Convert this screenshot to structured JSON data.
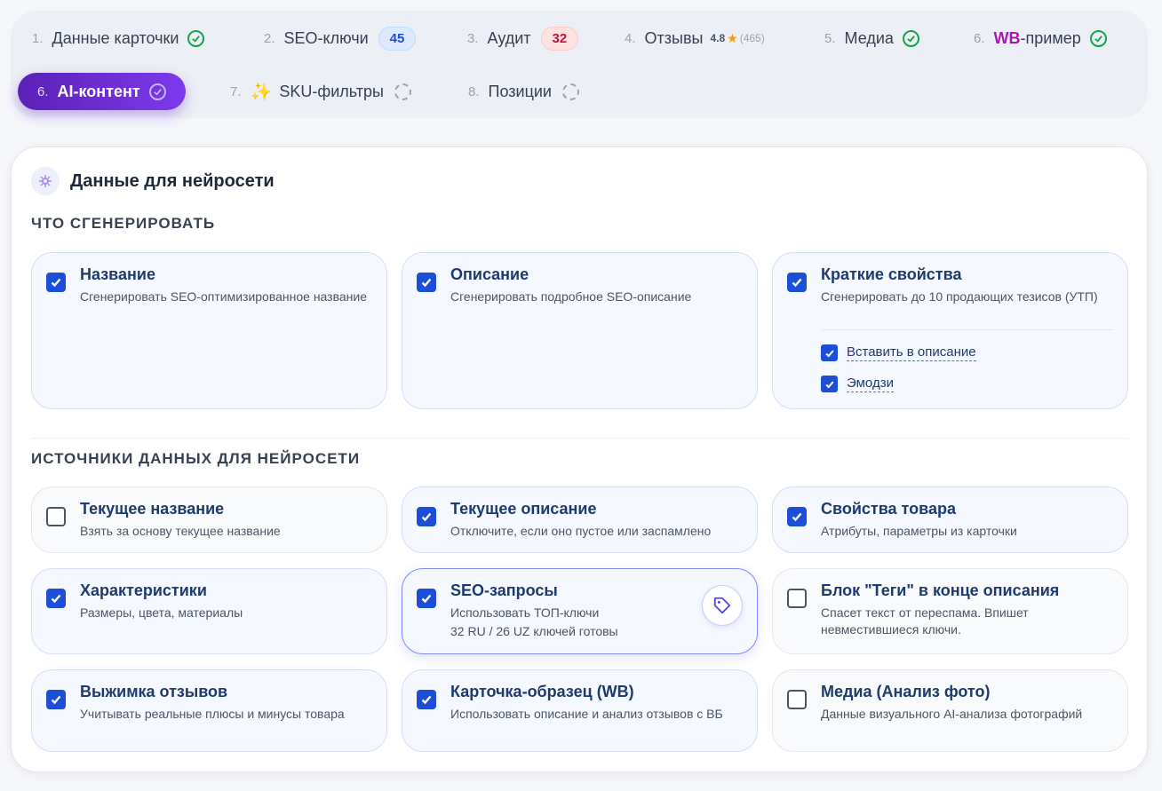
{
  "tabs": [
    {
      "num": "1.",
      "label": "Данные карточки",
      "status": "done"
    },
    {
      "num": "2.",
      "label": "SEO-ключи",
      "badge": "45"
    },
    {
      "num": "3.",
      "label": "Аудит",
      "badge": "32"
    },
    {
      "num": "4.",
      "label": "Отзывы",
      "rating": "4.8",
      "rating_count": "(465)"
    },
    {
      "num": "5.",
      "label": "Медиа",
      "status": "done"
    },
    {
      "num": "6.",
      "label_brand": "WB",
      "label_rest": "-пример",
      "status": "done"
    },
    {
      "num": "6.",
      "label": "AI-контент",
      "status": "done",
      "active": true
    },
    {
      "num": "7.",
      "label": "SKU-фильтры",
      "status": "pending"
    },
    {
      "num": "8.",
      "label": "Позиции",
      "status": "pending"
    }
  ],
  "card": {
    "title": "Данные для нейросети",
    "section_generate": "ЧТО СГЕНЕРИРОВАТЬ",
    "section_sources": "ИСТОЧНИКИ ДАННЫХ ДЛЯ НЕЙРОСЕТИ"
  },
  "generate": [
    {
      "title": "Название",
      "desc": "Сгенерировать SEO-оптимизированное название",
      "checked": true
    },
    {
      "title": "Описание",
      "desc": "Сгенерировать подробное SEO-описание",
      "checked": true
    },
    {
      "title": "Краткие свойства",
      "desc": "Сгенерировать до 10 продающих тезисов (УТП)",
      "checked": true,
      "sub": [
        {
          "label": "Вставить в описание",
          "checked": true
        },
        {
          "label": "Эмодзи",
          "checked": true
        }
      ]
    }
  ],
  "sources": [
    {
      "title": "Текущее название",
      "desc": "Взять за основу текущее название",
      "checked": false
    },
    {
      "title": "Текущее описание",
      "desc": "Отключите, если оно пустое или заспамлено",
      "checked": true
    },
    {
      "title": "Свойства товара",
      "desc": "Атрибуты, параметры из карточки",
      "checked": true
    },
    {
      "title": "Характеристики",
      "desc": "Размеры, цвета, материалы",
      "checked": true
    },
    {
      "title": "SEO-запросы",
      "desc": "Использовать ТОП-ключи",
      "extra": "32 RU / 26 UZ ключей готовы",
      "checked": true
    },
    {
      "title": "Блок \"Теги\" в конце описания",
      "desc": "Спасет текст от переспама. Впишет невместившиеся ключи.",
      "checked": false
    },
    {
      "title": "Выжимка отзывов",
      "desc": "Учитывать реальные плюсы и минусы товара",
      "checked": true
    },
    {
      "title": "Карточка-образец (WB)",
      "desc": "Использовать описание и анализ отзывов с ВБ",
      "checked": true
    },
    {
      "title": "Медиа (Анализ фото)",
      "desc": "Данные визуального AI-анализа фотографий",
      "checked": false
    }
  ],
  "colors": {
    "accent": "#7c3aed",
    "checkbox": "#1d4ed8",
    "ok": "#16a34a"
  }
}
